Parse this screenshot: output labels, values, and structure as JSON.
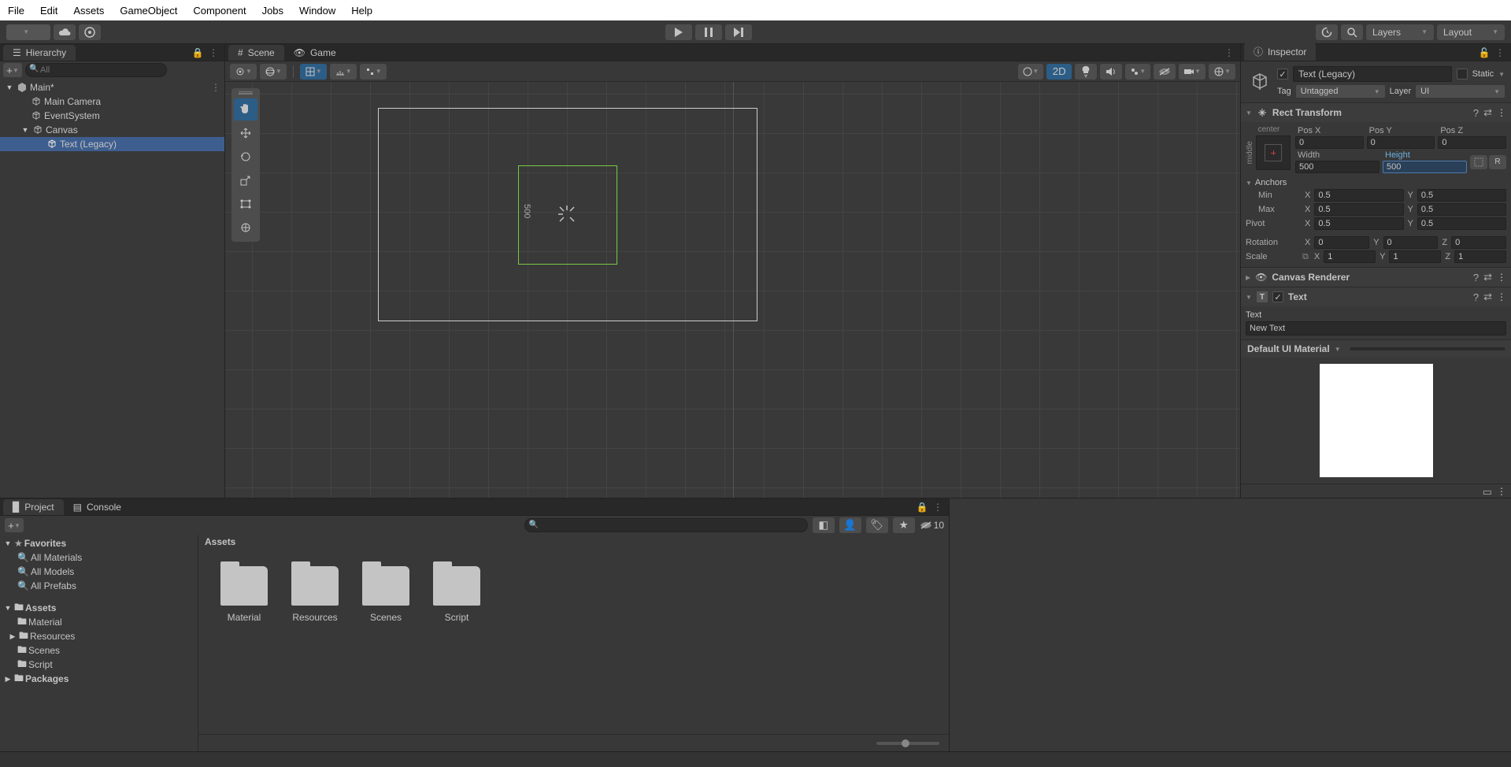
{
  "menubar": [
    "File",
    "Edit",
    "Assets",
    "GameObject",
    "Component",
    "Jobs",
    "Window",
    "Help"
  ],
  "toolbar": {
    "layers_label": "Layers",
    "layout_label": "Layout"
  },
  "hierarchy": {
    "tab": "Hierarchy",
    "search_placeholder": "All",
    "items": [
      {
        "label": "Main*",
        "indent": 0,
        "expanded": true,
        "icon": "unity"
      },
      {
        "label": "Main Camera",
        "indent": 1,
        "icon": "go"
      },
      {
        "label": "EventSystem",
        "indent": 1,
        "icon": "go"
      },
      {
        "label": "Canvas",
        "indent": 1,
        "expanded": true,
        "icon": "go"
      },
      {
        "label": "Text (Legacy)",
        "indent": 2,
        "icon": "go",
        "selected": true
      }
    ]
  },
  "scene": {
    "tabs": [
      {
        "label": "Scene",
        "active": true,
        "icon": "#"
      },
      {
        "label": "Game",
        "active": false,
        "icon": "∞"
      }
    ],
    "mode_2d": "2D",
    "canvas_label": "500"
  },
  "inspector": {
    "tab": "Inspector",
    "static_label": "Static",
    "name": "Text (Legacy)",
    "tag_label": "Tag",
    "tag_value": "Untagged",
    "layer_label": "Layer",
    "layer_value": "UI",
    "rect_transform": {
      "title": "Rect Transform",
      "center_label": "center",
      "middle_label": "middle",
      "pos_x_label": "Pos X",
      "pos_x": "0",
      "pos_y_label": "Pos Y",
      "pos_y": "0",
      "pos_z_label": "Pos Z",
      "pos_z": "0",
      "width_label": "Width",
      "width": "500",
      "height_label": "Height",
      "height": "500",
      "anchors_label": "Anchors",
      "min_label": "Min",
      "min_x": "0.5",
      "min_y": "0.5",
      "max_label": "Max",
      "max_x": "0.5",
      "max_y": "0.5",
      "pivot_label": "Pivot",
      "pivot_x": "0.5",
      "pivot_y": "0.5",
      "rotation_label": "Rotation",
      "rot_x": "0",
      "rot_y": "0",
      "rot_z": "0",
      "scale_label": "Scale",
      "scale_x": "1",
      "scale_y": "1",
      "scale_z": "1",
      "r_label": "R"
    },
    "canvas_renderer": {
      "title": "Canvas Renderer"
    },
    "text_component": {
      "title": "Text",
      "text_label": "Text",
      "text_value": "New Text"
    },
    "material": {
      "title": "Default UI Material"
    }
  },
  "project": {
    "tabs": [
      {
        "label": "Project",
        "icon": "folder",
        "active": true
      },
      {
        "label": "Console",
        "icon": "console",
        "active": false
      }
    ],
    "hidden_count": "10",
    "favorites_label": "Favorites",
    "favorites": [
      "All Materials",
      "All Models",
      "All Prefabs"
    ],
    "assets_label": "Assets",
    "assets_tree": [
      "Material",
      "Resources",
      "Scenes",
      "Script"
    ],
    "packages_label": "Packages",
    "breadcrumb": "Assets",
    "folders": [
      "Material",
      "Resources",
      "Scenes",
      "Script"
    ]
  }
}
